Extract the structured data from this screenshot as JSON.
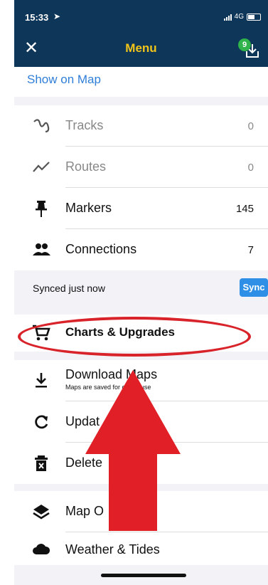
{
  "status_bar": {
    "time": "15:33",
    "location_glyph": "➤",
    "network": "4G"
  },
  "nav": {
    "close_label": "✕",
    "title": "Menu",
    "badge_count": "9"
  },
  "show_on_map": "Show on Map",
  "list1": [
    {
      "name": "tracks",
      "icon": "tracks-icon",
      "label": "Tracks",
      "count": "0"
    },
    {
      "name": "routes",
      "icon": "routes-icon",
      "label": "Routes",
      "count": "0"
    },
    {
      "name": "markers",
      "icon": "pin-icon",
      "label": "Markers",
      "count": "145"
    },
    {
      "name": "connections",
      "icon": "people-icon",
      "label": "Connections",
      "count": "7"
    }
  ],
  "sync": {
    "status": "Synced just now",
    "button": "Sync"
  },
  "charts_upgrades": {
    "icon": "cart-icon",
    "label": "Charts & Upgrades"
  },
  "list2": [
    {
      "name": "download-maps",
      "icon": "download-icon",
      "label": "Download Maps",
      "sublabel": "Maps are saved for offline use"
    },
    {
      "name": "update",
      "icon": "refresh-icon",
      "label": "Updat"
    },
    {
      "name": "delete",
      "icon": "trash-icon",
      "label": "Delete"
    }
  ],
  "list3": [
    {
      "name": "map-options",
      "icon": "layers-icon",
      "label": "Map O"
    },
    {
      "name": "weather-tides",
      "icon": "cloud-icon",
      "label": "Weather & Tides"
    }
  ],
  "colors": {
    "nav_bg": "#0e3658",
    "title": "#f0c419",
    "link": "#2f7ed8",
    "sync_btn": "#2f8fe6",
    "annotation": "#d9232a"
  }
}
